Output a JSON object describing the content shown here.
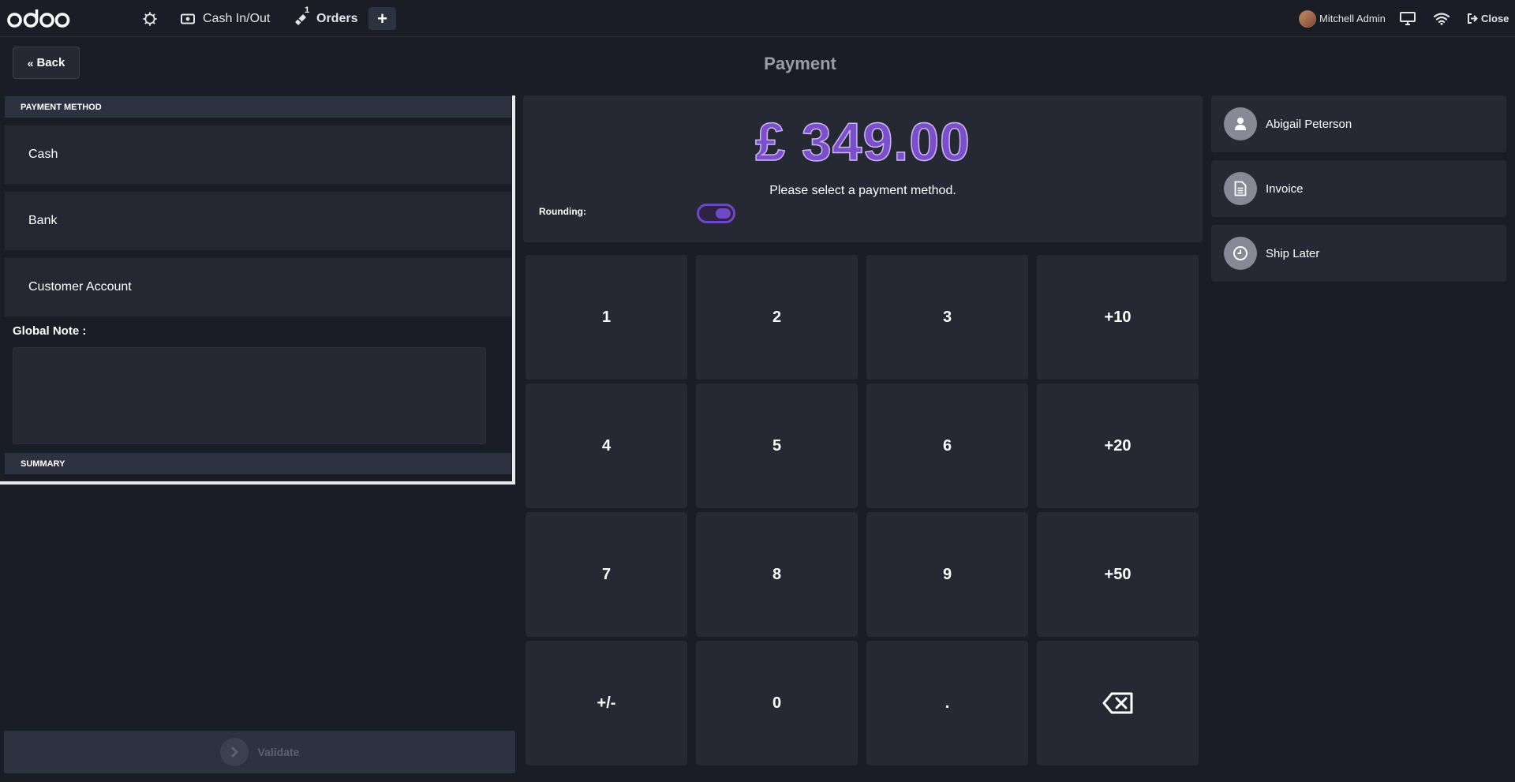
{
  "navbar": {
    "cash_label": "Cash In/Out",
    "orders_label": "Orders",
    "orders_badge": "1",
    "new_order": "+",
    "user_name": "Mitchell Admin",
    "close_label": "Close"
  },
  "header": {
    "back_label": "Back",
    "title": "Payment"
  },
  "payment_methods": {
    "header": "PAYMENT METHOD",
    "items": [
      {
        "label": "Cash"
      },
      {
        "label": "Bank"
      },
      {
        "label": "Customer Account"
      }
    ]
  },
  "note": {
    "label": "Global Note :",
    "value": ""
  },
  "summary": {
    "header": "SUMMARY"
  },
  "validate": {
    "label": "Validate"
  },
  "amount": {
    "total": "£ 349.00",
    "message": "Please select a payment method.",
    "rounding_label": "Rounding:",
    "rounding_enabled": true
  },
  "numpad": [
    [
      "1",
      "2",
      "3",
      "+10"
    ],
    [
      "4",
      "5",
      "6",
      "+20"
    ],
    [
      "7",
      "8",
      "9",
      "+50"
    ],
    [
      "+/-",
      "0",
      ".",
      "backspace"
    ]
  ],
  "actions": [
    {
      "label": "Abigail Peterson",
      "icon": "person-icon"
    },
    {
      "label": "Invoice",
      "icon": "file-icon"
    },
    {
      "label": "Ship Later",
      "icon": "clock-icon"
    }
  ],
  "colors": {
    "accent": "#6f48c2",
    "background": "#1b1d26",
    "panel": "#262833"
  }
}
